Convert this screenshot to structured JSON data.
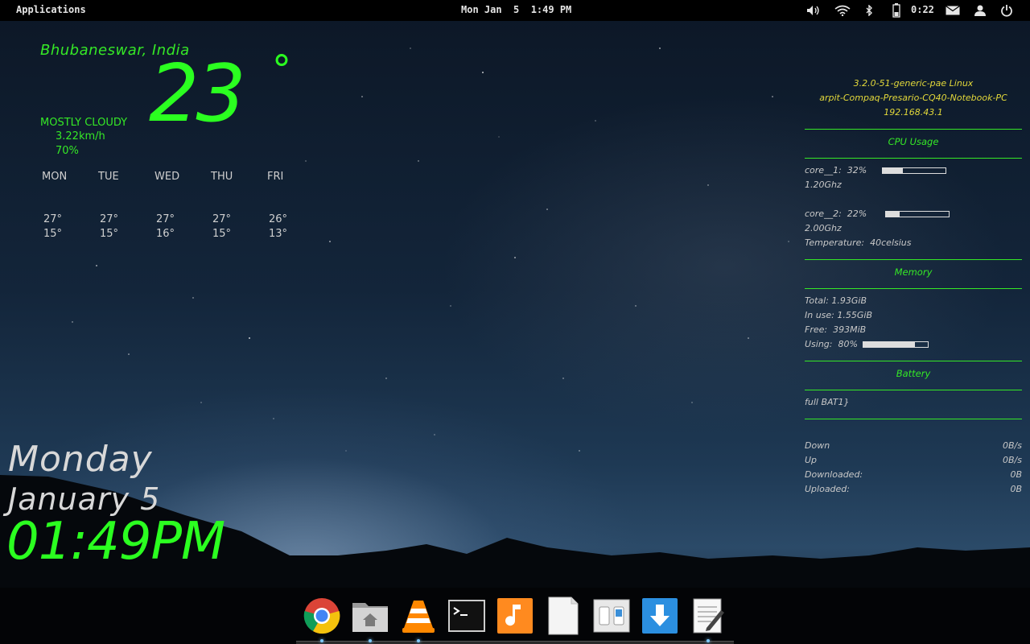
{
  "colors": {
    "accent_green": "#2bff20",
    "conky_header_yellow": "#e2d83a",
    "panel_bg": "#000000"
  },
  "top_panel": {
    "applications_label": "Applications",
    "clock": "Mon Jan  5  1:49 PM",
    "battery_time": "0:22",
    "tray_icons": [
      "volume-icon",
      "wifi-icon",
      "bluetooth-icon",
      "battery-icon",
      "mail-icon",
      "user-icon",
      "power-icon"
    ]
  },
  "weather": {
    "location": "Bhubaneswar, India",
    "temperature": "23",
    "degree_symbol": "°",
    "condition": "MOSTLY CLOUDY",
    "wind": "3.22km/h",
    "humidity": "70%",
    "forecast": [
      {
        "day": "MON",
        "high": "27°",
        "low": "15°"
      },
      {
        "day": "TUE",
        "high": "27°",
        "low": "15°"
      },
      {
        "day": "WED",
        "high": "27°",
        "low": "16°"
      },
      {
        "day": "THU",
        "high": "27°",
        "low": "15°"
      },
      {
        "day": "FRI",
        "high": "26°",
        "low": "13°"
      }
    ]
  },
  "date_widget": {
    "day_name": "Monday",
    "month_day": "January  5",
    "time": "01:49PM"
  },
  "conky": {
    "kernel": "3.2.0-51-generic-pae Linux",
    "hostname": "arpit-Compaq-Presario-CQ40-Notebook-PC",
    "ip": "192.168.43.1",
    "cpu_header": "CPU Usage",
    "core1_label": "core__1:  32%",
    "core1_percent": 32,
    "core1_freq": "1.20Ghz",
    "core2_label": "core__2:  22%",
    "core2_percent": 22,
    "core2_freq": "2.00Ghz",
    "temperature": "Temperature:  40celsius",
    "memory_header": "Memory",
    "mem_total": "Total: 1.93GiB",
    "mem_inuse": "In use: 1.55GiB",
    "mem_free": "Free:  393MiB",
    "mem_using_label": "Using:  80%",
    "mem_using_percent": 80,
    "battery_header": "Battery",
    "battery_status": "full BAT1}",
    "net_down_label": "Down",
    "net_down_value": "0B/s",
    "net_up_label": "Up",
    "net_up_value": "0B/s",
    "net_downloaded_label": "Downloaded:",
    "net_downloaded_value": "0B",
    "net_uploaded_label": "Uploaded:",
    "net_uploaded_value": "0B"
  },
  "dock": {
    "items": [
      {
        "name": "chrome-icon",
        "running": true
      },
      {
        "name": "home-folder-icon",
        "running": true
      },
      {
        "name": "vlc-icon",
        "running": true
      },
      {
        "name": "terminal-icon",
        "running": false
      },
      {
        "name": "music-player-icon",
        "running": false
      },
      {
        "name": "document-icon",
        "running": false
      },
      {
        "name": "switcher-icon",
        "running": false
      },
      {
        "name": "download-icon",
        "running": false
      },
      {
        "name": "text-editor-icon",
        "running": true
      }
    ]
  }
}
